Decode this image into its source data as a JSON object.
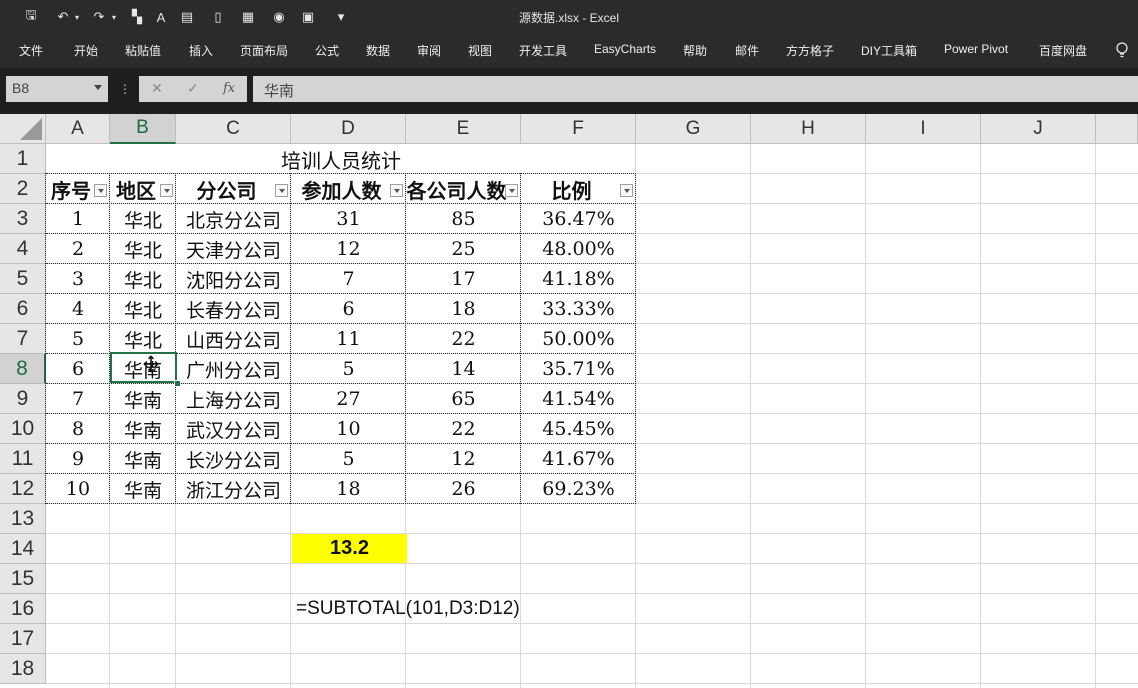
{
  "window": {
    "title": "源数据.xlsx  -  Excel"
  },
  "quick_access": [
    {
      "name": "save-icon",
      "glyph": "🖫"
    },
    {
      "name": "undo-icon",
      "glyph": "↶"
    },
    {
      "name": "redo-icon",
      "glyph": "↷"
    },
    {
      "name": "format-painter-icon",
      "glyph": "▚"
    },
    {
      "name": "font-color-icon",
      "glyph": "A"
    },
    {
      "name": "paste-icon",
      "glyph": "▤"
    },
    {
      "name": "document-icon",
      "glyph": "▯"
    },
    {
      "name": "grid-icon",
      "glyph": "▦"
    },
    {
      "name": "camera-icon",
      "glyph": "◉"
    },
    {
      "name": "form-icon",
      "glyph": "▣"
    },
    {
      "name": "customize-qat-icon",
      "glyph": "▾"
    }
  ],
  "ribbon_tabs": [
    "文件",
    "开始",
    "粘贴值",
    "插入",
    "页面布局",
    "公式",
    "数据",
    "审阅",
    "视图",
    "开发工具",
    "EasyCharts",
    "帮助",
    "邮件",
    "方方格子",
    "DIY工具箱",
    "Power Pivot",
    "百度网盘"
  ],
  "formula_bar": {
    "name_box": "B8",
    "dots": "⋮",
    "cancel": "✕",
    "enter": "✓",
    "fx": "fx",
    "content": "华南"
  },
  "columns": [
    "A",
    "B",
    "C",
    "D",
    "E",
    "F",
    "G",
    "H",
    "I",
    "J"
  ],
  "rows": [
    "1",
    "2",
    "3",
    "4",
    "5",
    "6",
    "7",
    "8",
    "9",
    "10",
    "11",
    "12",
    "13",
    "14",
    "15",
    "16",
    "17",
    "18"
  ],
  "selected": {
    "column": "B",
    "row": "8"
  },
  "sheet": {
    "title": "培训人员统计",
    "headers": [
      "序号",
      "地区",
      "分公司",
      "参加人数",
      "各公司人数",
      "比例"
    ],
    "rows": [
      [
        "1",
        "华北",
        "北京分公司",
        "31",
        "85",
        "36.47%"
      ],
      [
        "2",
        "华北",
        "天津分公司",
        "12",
        "25",
        "48.00%"
      ],
      [
        "3",
        "华北",
        "沈阳分公司",
        "7",
        "17",
        "41.18%"
      ],
      [
        "4",
        "华北",
        "长春分公司",
        "6",
        "18",
        "33.33%"
      ],
      [
        "5",
        "华北",
        "山西分公司",
        "11",
        "22",
        "50.00%"
      ],
      [
        "6",
        "华南",
        "广州分公司",
        "5",
        "14",
        "35.71%"
      ],
      [
        "7",
        "华南",
        "上海分公司",
        "27",
        "65",
        "41.54%"
      ],
      [
        "8",
        "华南",
        "武汉分公司",
        "10",
        "22",
        "45.45%"
      ],
      [
        "9",
        "华南",
        "长沙分公司",
        "5",
        "12",
        "41.67%"
      ],
      [
        "10",
        "华南",
        "浙江分公司",
        "18",
        "26",
        "69.23%"
      ]
    ],
    "result_value": "13.2",
    "formula_text": "=SUBTOTAL(101,D3:D12)"
  },
  "colors": {
    "accent": "#217346",
    "highlight": "#ffff00",
    "titlebar": "#2b2b2b"
  }
}
